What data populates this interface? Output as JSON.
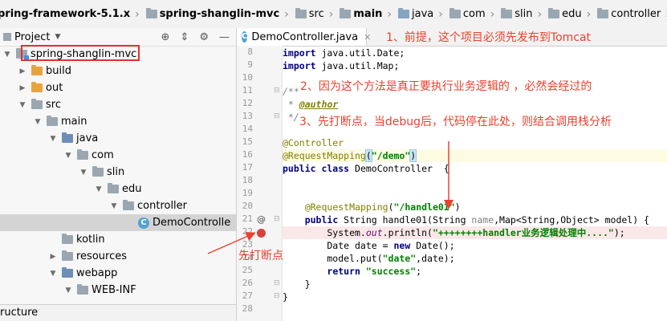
{
  "breadcrumb": [
    {
      "label": "pring-framework-5.1.x",
      "icon": "folder",
      "bold": true
    },
    {
      "label": "spring-shanglin-mvc",
      "icon": "folder",
      "bold": true
    },
    {
      "label": "src",
      "icon": "folder",
      "bold": false
    },
    {
      "label": "main",
      "icon": "folder",
      "bold": true
    },
    {
      "label": "java",
      "icon": "folder-blue",
      "bold": false
    },
    {
      "label": "com",
      "icon": "folder",
      "bold": false
    },
    {
      "label": "slin",
      "icon": "folder",
      "bold": false
    },
    {
      "label": "edu",
      "icon": "folder",
      "bold": false
    },
    {
      "label": "controller",
      "icon": "folder",
      "bold": false
    },
    {
      "label": "DemoController",
      "icon": "class",
      "bold": false
    }
  ],
  "project": {
    "title": "Project",
    "structure_label": "ructure",
    "tree": [
      {
        "label": "spring-shanglin-mvc",
        "depth": 0,
        "expanded": true,
        "icon": "module",
        "highlighted": true
      },
      {
        "label": "build",
        "depth": 1,
        "expanded": false,
        "icon": "orange"
      },
      {
        "label": "out",
        "depth": 1,
        "expanded": false,
        "icon": "orange"
      },
      {
        "label": "src",
        "depth": 1,
        "expanded": true,
        "icon": "gray"
      },
      {
        "label": "main",
        "depth": 2,
        "expanded": true,
        "icon": "gray"
      },
      {
        "label": "java",
        "depth": 3,
        "expanded": true,
        "icon": "blue"
      },
      {
        "label": "com",
        "depth": 4,
        "expanded": true,
        "icon": "gray"
      },
      {
        "label": "slin",
        "depth": 5,
        "expanded": true,
        "icon": "gray"
      },
      {
        "label": "edu",
        "depth": 6,
        "expanded": true,
        "icon": "gray"
      },
      {
        "label": "controller",
        "depth": 7,
        "expanded": true,
        "icon": "gray"
      },
      {
        "label": "DemoControlle",
        "depth": 8,
        "expanded": null,
        "icon": "class",
        "selected": true
      },
      {
        "label": "kotlin",
        "depth": 3,
        "expanded": null,
        "icon": "gray"
      },
      {
        "label": "resources",
        "depth": 3,
        "expanded": false,
        "icon": "gray"
      },
      {
        "label": "webapp",
        "depth": 3,
        "expanded": true,
        "icon": "blue"
      },
      {
        "label": "WEB-INF",
        "depth": 4,
        "expanded": true,
        "icon": "gray"
      }
    ]
  },
  "editor": {
    "tab_label": "DemoController.java",
    "gutter_numbers": [
      "8",
      "9",
      "10",
      "11",
      "12",
      "13",
      "14",
      "15",
      "16",
      "17",
      "18",
      "19",
      "20",
      "21",
      "22",
      "23",
      "24",
      "25",
      "26",
      "27",
      "28"
    ],
    "code_lines": [
      [
        [
          "kw",
          "import "
        ],
        [
          "",
          "java.util.Date;"
        ]
      ],
      [
        [
          "kw",
          "import "
        ],
        [
          "",
          "java.util.Map;"
        ]
      ],
      [],
      [
        [
          "cm",
          "/**"
        ]
      ],
      [
        [
          "cm",
          " * "
        ],
        [
          "tag",
          "@author"
        ]
      ],
      [
        [
          "cm",
          " */"
        ]
      ],
      [],
      [
        [
          "ann",
          "@Controller"
        ]
      ],
      [
        [
          "ann",
          "@RequestMapping"
        ],
        [
          "brk",
          "("
        ],
        [
          "str",
          "\"/demo\""
        ],
        [
          "brk",
          ")"
        ]
      ],
      [
        [
          "kw",
          "public class "
        ],
        [
          "",
          "DemoController  {"
        ]
      ],
      [],
      [],
      [
        [
          "",
          "    "
        ],
        [
          "ann",
          "@RequestMapping"
        ],
        [
          "",
          "("
        ],
        [
          "str",
          "\"/handle01\""
        ],
        [
          "",
          ")"
        ]
      ],
      [
        [
          "",
          "    "
        ],
        [
          "kw",
          "public "
        ],
        [
          "",
          "String handle01(String "
        ],
        [
          "param-hint",
          "name"
        ],
        [
          "",
          ",Map<String,Object> model) {"
        ]
      ],
      [
        [
          "",
          "        System."
        ],
        [
          "static-m",
          "out"
        ],
        [
          "",
          ".println("
        ],
        [
          "str",
          "\"++++++++handler业务逻辑处理中....\""
        ],
        [
          "",
          ");"
        ]
      ],
      [
        [
          "",
          "        Date date = "
        ],
        [
          "kw",
          "new "
        ],
        [
          "",
          "Date();"
        ]
      ],
      [
        [
          "",
          "        model.put("
        ],
        [
          "str",
          "\"date\""
        ],
        [
          "",
          ",date);"
        ]
      ],
      [
        [
          "",
          "        "
        ],
        [
          "kw",
          "return "
        ],
        [
          "str",
          "\"success\""
        ],
        [
          "",
          ";"
        ]
      ],
      [
        [
          "",
          "    }"
        ]
      ],
      [
        [
          "",
          "}"
        ]
      ],
      []
    ]
  },
  "annotations": {
    "note1": "1、前提，这个项目必须先发布到Tomcat",
    "note2": "2、因为这个方法是真正要执行业务逻辑的 ，必然会经过的",
    "note3": "3、先打断点，当debug后，代码停在此处，则结合调用栈分析",
    "breakpoint_note": "先打断点"
  },
  "colors": {
    "annotation_red": "#e8422f",
    "keyword": "#000080",
    "string": "#008000",
    "annotation": "#808000",
    "breakpoint": "#d9413b"
  }
}
